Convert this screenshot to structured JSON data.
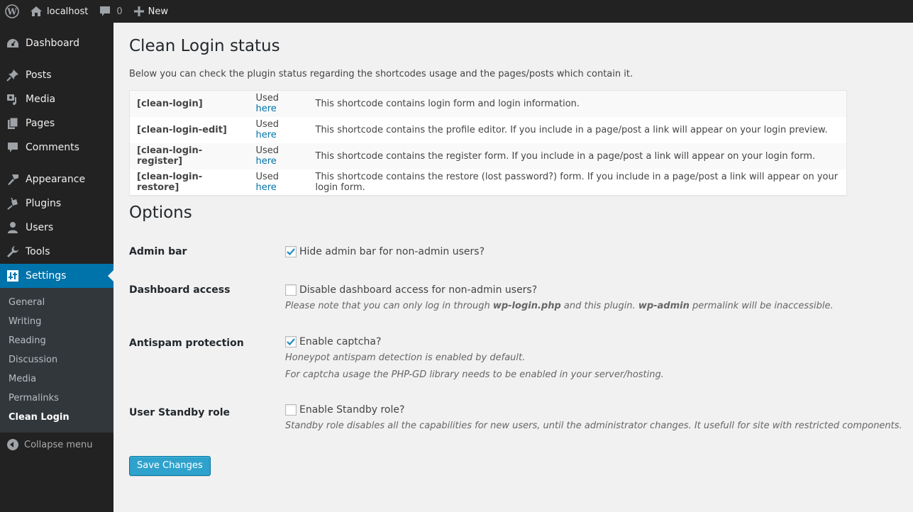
{
  "adminbar": {
    "site_name": "localhost",
    "comments_count": "0",
    "new_label": "New",
    "icons": {
      "wp": "wordpress-logo-icon",
      "home": "home-icon",
      "comments": "comment-bubble-icon",
      "new": "plus-icon"
    }
  },
  "sidebar": {
    "items": [
      {
        "label": "Dashboard",
        "icon": "dashboard-icon"
      },
      {
        "label": "Posts",
        "icon": "pin-icon"
      },
      {
        "label": "Media",
        "icon": "media-icon"
      },
      {
        "label": "Pages",
        "icon": "pages-icon"
      },
      {
        "label": "Comments",
        "icon": "comment-icon"
      },
      {
        "label": "Appearance",
        "icon": "paintbrush-icon"
      },
      {
        "label": "Plugins",
        "icon": "plugin-icon"
      },
      {
        "label": "Users",
        "icon": "user-icon"
      },
      {
        "label": "Tools",
        "icon": "wrench-icon"
      },
      {
        "label": "Settings",
        "icon": "settings-sliders-icon",
        "current": true
      }
    ],
    "submenu": [
      "General",
      "Writing",
      "Reading",
      "Discussion",
      "Media",
      "Permalinks",
      "Clean Login"
    ],
    "submenu_current": "Clean Login",
    "collapse_label": "Collapse menu",
    "accent": "#0073aa"
  },
  "main": {
    "title": "Clean Login status",
    "intro": "Below you can check the plugin status regarding the shortcodes usage and the pages/posts which contain it.",
    "shortcodes": [
      {
        "code": "[clean-login]",
        "used_prefix": "Used",
        "used_link": "here",
        "description": "This shortcode contains login form and login information."
      },
      {
        "code": "[clean-login-edit]",
        "used_prefix": "Used",
        "used_link": "here",
        "description": "This shortcode contains the profile editor. If you include in a page/post a link will appear on your login preview."
      },
      {
        "code": "[clean-login-register]",
        "used_prefix": "Used",
        "used_link": "here",
        "description": "This shortcode contains the register form. If you include in a page/post a link will appear on your login form."
      },
      {
        "code": "[clean-login-restore]",
        "used_prefix": "Used",
        "used_link": "here",
        "description": "This shortcode contains the restore (lost password?) form. If you include in a page/post a link will appear on your login form."
      }
    ],
    "options_title": "Options",
    "options": {
      "admin_bar": {
        "label": "Admin bar",
        "checkbox_label": "Hide admin bar for non-admin users?",
        "checked": true
      },
      "dashboard_access": {
        "label": "Dashboard access",
        "checkbox_label": "Disable dashboard access for non-admin users?",
        "checked": false,
        "desc_1": "Please note that you can only log in through ",
        "desc_bold_1": "wp-login.php",
        "desc_2": " and this plugin. ",
        "desc_bold_2": "wp-admin",
        "desc_3": " permalink will be inaccessible."
      },
      "antispam": {
        "label": "Antispam protection",
        "checkbox_label": "Enable captcha?",
        "checked": true,
        "desc_1": "Honeypot antispam detection is enabled by default.",
        "desc_2": "For captcha usage the PHP-GD library needs to be enabled in your server/hosting."
      },
      "standby": {
        "label": "User Standby role",
        "checkbox_label": "Enable Standby role?",
        "checked": false,
        "desc": "Standby role disables all the capabilities for new users, until the administrator changes. It usefull for site with restricted components."
      }
    },
    "save_label": "Save Changes"
  }
}
